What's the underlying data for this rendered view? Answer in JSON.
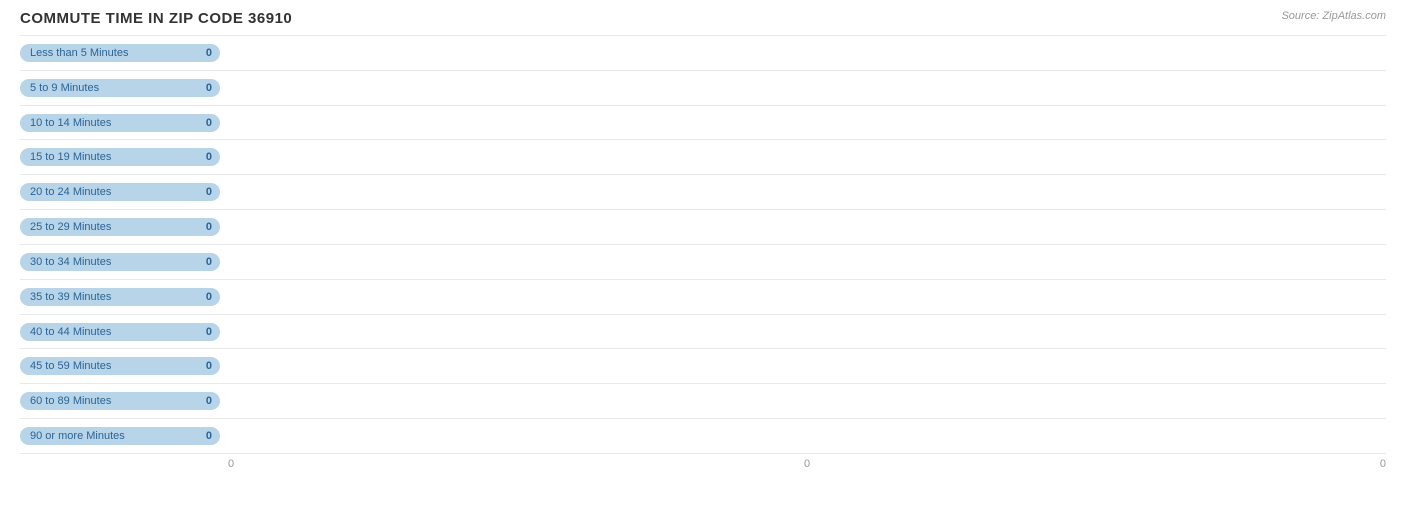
{
  "title": "COMMUTE TIME IN ZIP CODE 36910",
  "source": "Source: ZipAtlas.com",
  "rows": [
    {
      "label": "Less than 5 Minutes",
      "value": 0
    },
    {
      "label": "5 to 9 Minutes",
      "value": 0
    },
    {
      "label": "10 to 14 Minutes",
      "value": 0
    },
    {
      "label": "15 to 19 Minutes",
      "value": 0
    },
    {
      "label": "20 to 24 Minutes",
      "value": 0
    },
    {
      "label": "25 to 29 Minutes",
      "value": 0
    },
    {
      "label": "30 to 34 Minutes",
      "value": 0
    },
    {
      "label": "35 to 39 Minutes",
      "value": 0
    },
    {
      "label": "40 to 44 Minutes",
      "value": 0
    },
    {
      "label": "45 to 59 Minutes",
      "value": 0
    },
    {
      "label": "60 to 89 Minutes",
      "value": 0
    },
    {
      "label": "90 or more Minutes",
      "value": 0
    }
  ],
  "xAxis": {
    "ticks": [
      "0",
      "0",
      "0"
    ]
  }
}
